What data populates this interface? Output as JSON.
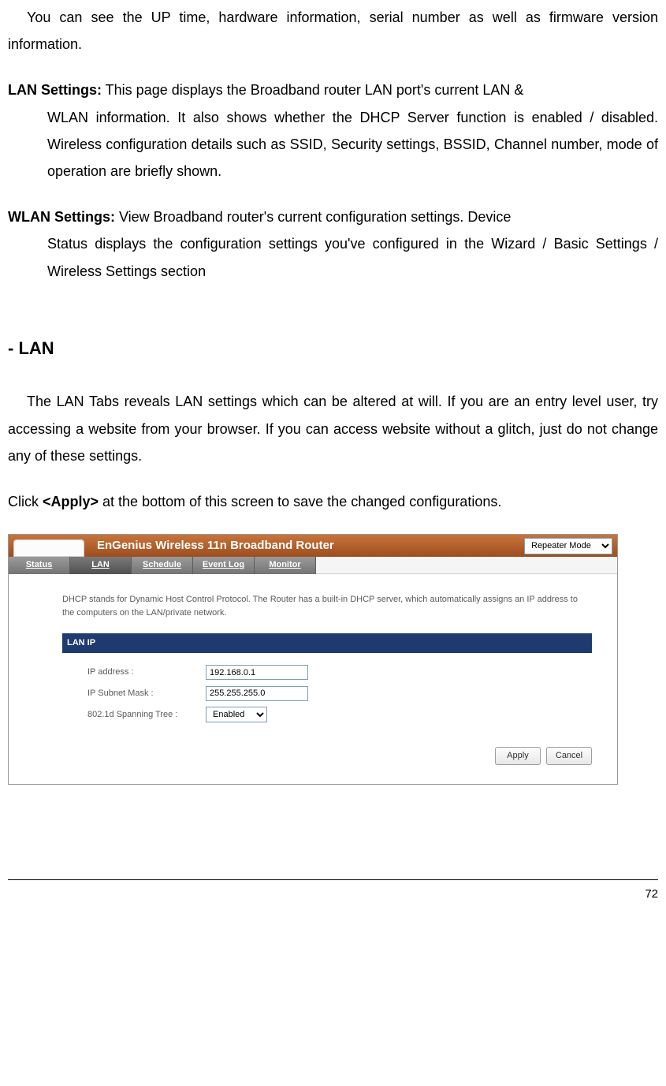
{
  "intro": "You can see the UP time, hardware information, serial number as well as firmware version information.",
  "lan_settings": {
    "label": "LAN Settings:",
    "text_first": " This page displays the Broadband router LAN port's current LAN &",
    "text_rest": "WLAN information. It also shows whether the DHCP Server function is enabled / disabled. Wireless configuration details such as SSID, Security settings, BSSID, Channel number, mode of operation are briefly shown."
  },
  "wlan_settings": {
    "label": "WLAN Settings:",
    "text_first": " View Broadband router's current configuration settings. Device",
    "text_rest": "Status displays the configuration settings you've configured in the Wizard / Basic Settings / Wireless Settings section"
  },
  "section_heading": "- LAN",
  "lan_intro": "The LAN Tabs reveals LAN settings which can be altered at will. If you are an entry level user, try accessing a website from your browser. If you can access website without a glitch, just do not change any of these settings.",
  "apply_line": {
    "pre": "Click ",
    "bold": "<Apply>",
    "post": " at the bottom of this screen to save the changed configurations."
  },
  "router": {
    "title": "EnGenius Wireless 11n Broadband Router",
    "mode": "Repeater Mode",
    "tabs": [
      "Status",
      "LAN",
      "Schedule",
      "Event Log",
      "Monitor"
    ],
    "dhcp_desc": "DHCP stands for Dynamic Host Control Protocol. The Router has a built-in DHCP server, which automatically assigns an IP address to the computers on the LAN/private network.",
    "section_bar": "LAN IP",
    "fields": {
      "ip_label": "IP address :",
      "ip_value": "192.168.0.1",
      "subnet_label": "IP Subnet Mask :",
      "subnet_value": "255.255.255.0",
      "spanning_label": "802.1d Spanning Tree :",
      "spanning_value": "Enabled"
    },
    "buttons": {
      "apply": "Apply",
      "cancel": "Cancel"
    }
  },
  "page_number": "72"
}
